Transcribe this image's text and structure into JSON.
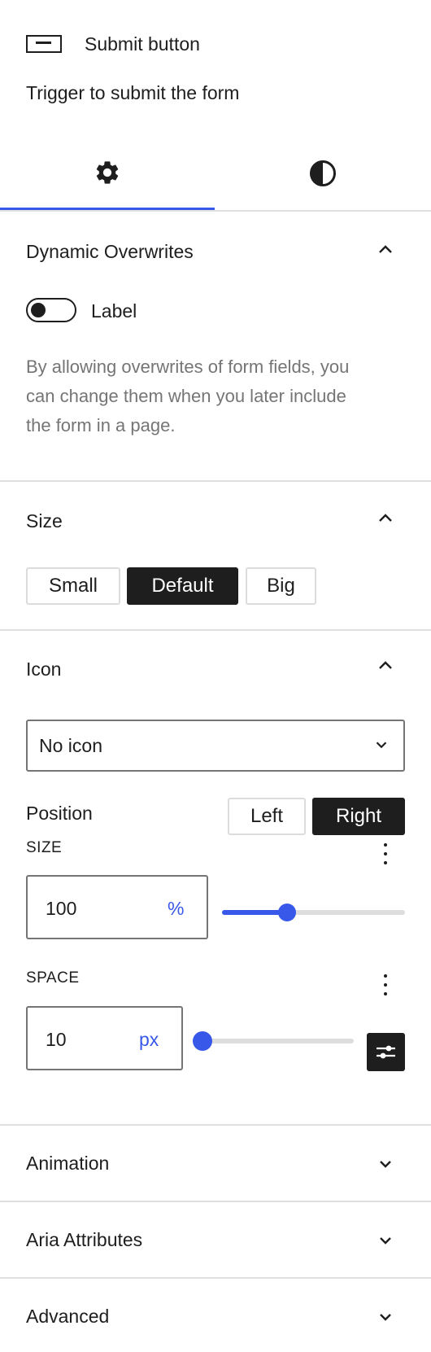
{
  "block": {
    "icon": "button-rectangle-icon",
    "title": "Submit button",
    "description": "Trigger to submit the form"
  },
  "tabs": [
    {
      "icon": "gear-icon",
      "active": true
    },
    {
      "icon": "half-circle-contrast-icon",
      "active": false
    }
  ],
  "dynamic_overwrites": {
    "title": "Dynamic Overwrites",
    "expanded": true,
    "toggle_label": "Label",
    "toggle_on": false,
    "help_lines": [
      "By allowing overwrites of form fields, you",
      "can change them when you later include",
      "the form in a page."
    ]
  },
  "size": {
    "title": "Size",
    "expanded": true,
    "options": [
      "Small",
      "Default",
      "Big"
    ],
    "selected": "Default"
  },
  "icon": {
    "title": "Icon",
    "expanded": true,
    "select_value": "No icon",
    "position_label": "Position",
    "position_options": [
      "Left",
      "Right"
    ],
    "position_selected": "Right",
    "size_label": "SIZE",
    "size_value": "100",
    "size_unit": "%",
    "size_slider_fraction": 0.34,
    "space_label": "SPACE",
    "space_value": "10",
    "space_unit": "px",
    "space_slider_fraction": 0.0
  },
  "collapsed_panels": [
    "Animation",
    "Aria Attributes",
    "Advanced"
  ],
  "colors": {
    "accent": "#3858e9",
    "text": "#1e1e1e",
    "muted": "#757575",
    "border": "#e0e0e0",
    "active_fill": "#1e1e1e"
  }
}
